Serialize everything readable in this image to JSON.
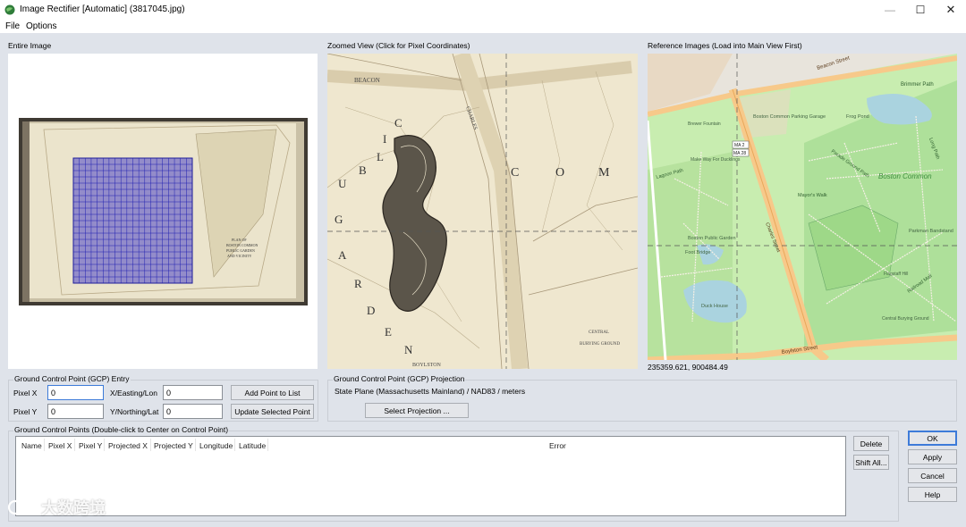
{
  "window": {
    "title": "Image Rectifier [Automatic] (3817045.jpg)",
    "minimize_glyph": "—",
    "maximize_glyph": "☐",
    "close_glyph": "✕"
  },
  "menu": [
    "File",
    "Options"
  ],
  "panels": {
    "entire_image_label": "Entire Image",
    "zoomed_view_label": "Zoomed View (Click for Pixel Coordinates)",
    "reference_images_label": "Reference Images (Load into Main View First)",
    "reference_coordinates": "235359.621, 900484.49"
  },
  "zoom_map": {
    "labels": [
      "BEACON",
      "CHARLES",
      "C",
      "O",
      "M",
      "U",
      "B",
      "L",
      "I",
      "C",
      "G",
      "A",
      "R",
      "D",
      "E",
      "N",
      "CENTRAL",
      "BURYING GROUND",
      "BOYLSTON"
    ]
  },
  "entire_map": {
    "caption": [
      "PLAN OF",
      "BOSTON COMMON",
      "PUBLIC GARDEN",
      "AND VICINITY"
    ]
  },
  "ref_map": {
    "labels": [
      "Beacon Street",
      "Brimmer Path",
      "Boston Common Parking Garage",
      "Frog Pond",
      "Boston Common",
      "Parade Ground Path",
      "Mayor's Walk",
      "Lagoon Path",
      "Charles Street",
      "Boston Public Garden",
      "Foot Bridge",
      "Duck House",
      "Central Burying Ground",
      "Boylston Street",
      "Parkman Bandstand",
      "MA 2",
      "MA 28",
      "Long Path",
      "Railroad Mall",
      "Make Way For Ducklings",
      "Brewer Fountain",
      "Flagstaff Hill"
    ]
  },
  "gcp_entry": {
    "title": "Ground Control Point (GCP) Entry",
    "pixel_x_label": "Pixel X",
    "pixel_x_value": "0",
    "pixel_y_label": "Pixel Y",
    "pixel_y_value": "0",
    "easting_label": "X/Easting/Lon",
    "easting_value": "0",
    "northing_label": "Y/Northing/Lat",
    "northing_value": "0",
    "add_point_button": "Add Point to List",
    "update_point_button": "Update Selected Point"
  },
  "gcp_projection": {
    "title": "Ground Control Point (GCP) Projection",
    "projection": "State Plane (Massachusetts Mainland) / NAD83 / meters",
    "select_button": "Select Projection ..."
  },
  "gcp_list": {
    "title": "Ground Control Points (Double-click to Center on Control Point)",
    "columns": [
      "Name",
      "Pixel X",
      "Pixel Y",
      "Projected X",
      "Projected Y",
      "Longitude",
      "Latitude",
      "Error"
    ],
    "rows": []
  },
  "list_buttons": {
    "delete": "Delete",
    "shift_all": "Shift All..."
  },
  "dialog_buttons": {
    "ok": "OK",
    "apply": "Apply",
    "cancel": "Cancel",
    "help": "Help"
  },
  "watermark": "大数跨境",
  "colors": {
    "window_bg": "#dfe3ea",
    "grid_blue": "#2a2ad6",
    "park_green": "#b8e6a6",
    "water_blue": "#aad3df",
    "road_orange": "#f7c98a",
    "focus_blue": "#3d7bd9"
  }
}
